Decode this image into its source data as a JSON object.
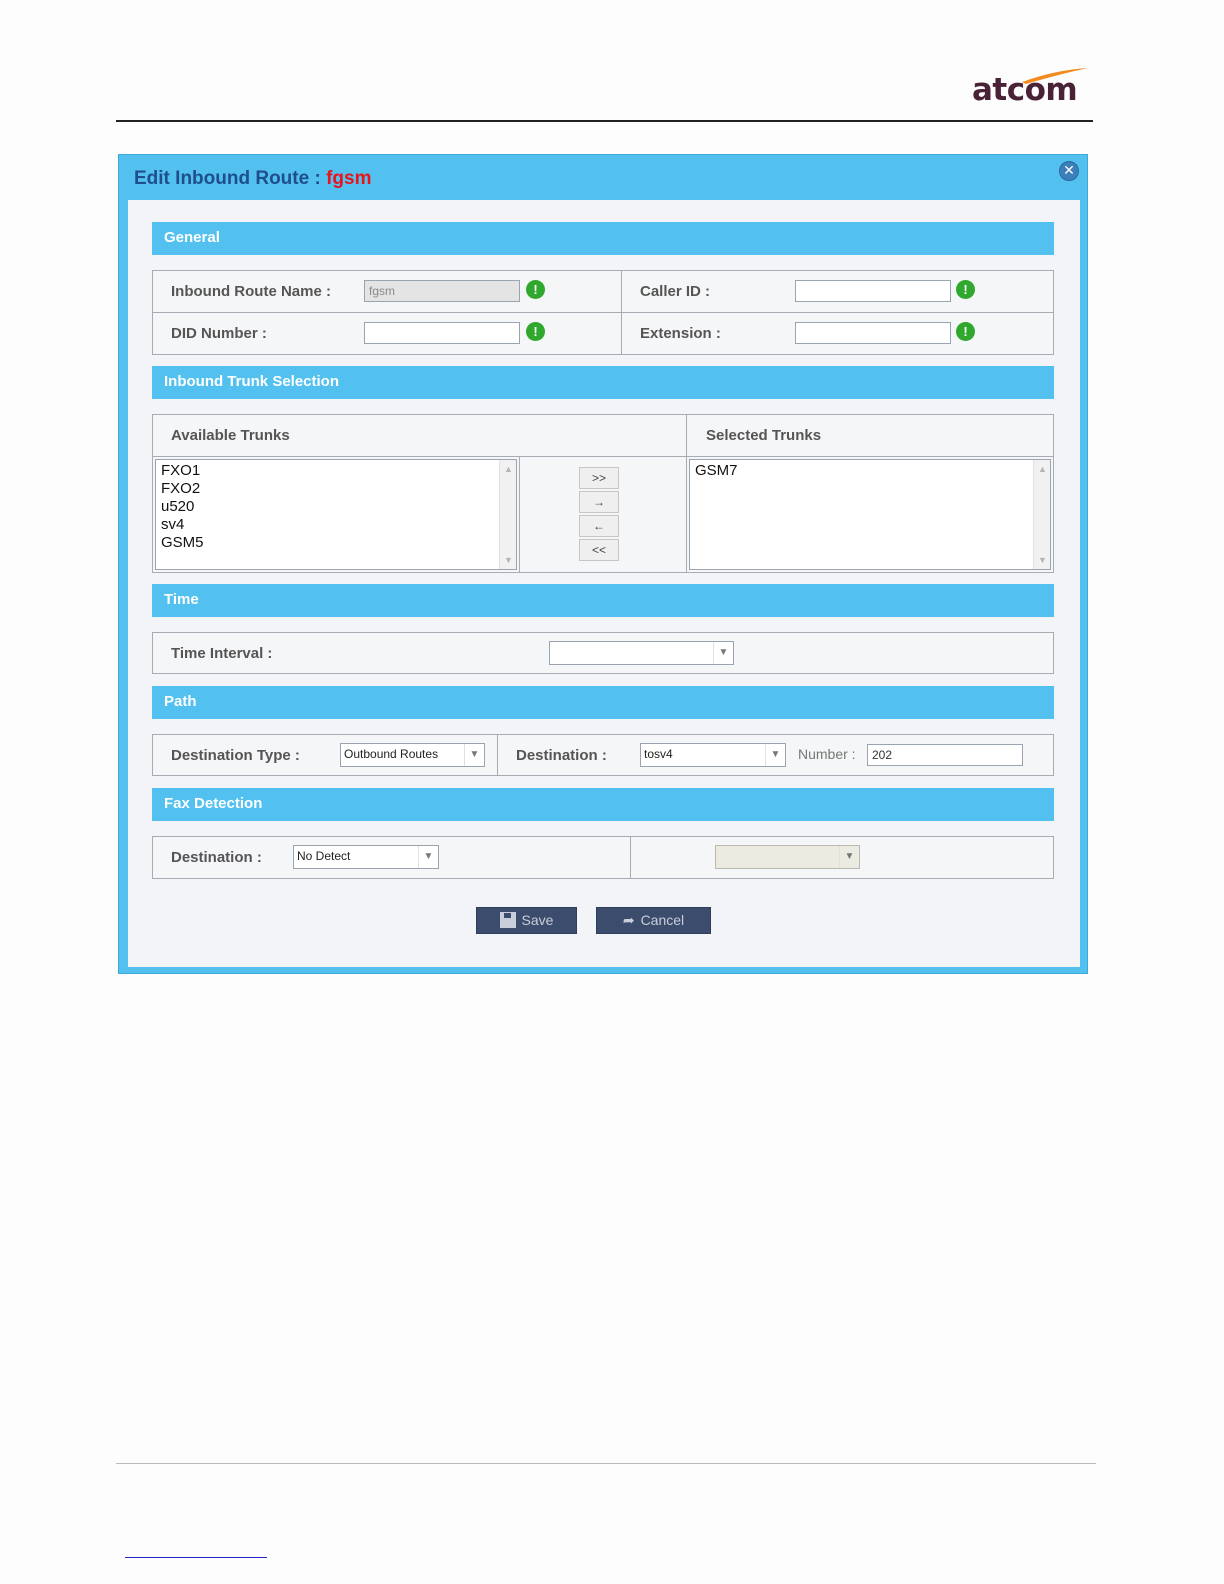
{
  "brand": {
    "logo": "atcom",
    "logo_color": "#4a2238",
    "swoosh_color": "#f28a1e"
  },
  "dialog": {
    "title_prefix": "Edit Inbound Route : ",
    "title_name": "fgsm",
    "close_glyph": "✕"
  },
  "general": {
    "header": "General",
    "route_name_label": "Inbound Route Name :",
    "route_name_value": "fgsm",
    "caller_id_label": "Caller ID :",
    "caller_id_value": "",
    "did_label": "DID Number :",
    "did_value": "",
    "extension_label": "Extension :",
    "extension_value": "",
    "warn_glyph": "!"
  },
  "trunks": {
    "header": "Inbound Trunk Selection",
    "available_label": "Available Trunks",
    "selected_label": "Selected Trunks",
    "available": [
      "FXO1",
      "FXO2",
      "u520",
      "sv4",
      "GSM5"
    ],
    "selected": [
      "GSM7"
    ],
    "buttons": {
      "add_all": ">>",
      "add": "→",
      "remove": "←",
      "remove_all": "<<"
    }
  },
  "time": {
    "header": "Time",
    "interval_label": "Time Interval :",
    "interval_value": ""
  },
  "path": {
    "header": "Path",
    "dest_type_label": "Destination Type :",
    "dest_type_value": "Outbound Routes",
    "destination_label": "Destination :",
    "destination_value": "tosv4",
    "number_label": "Number :",
    "number_value": "202"
  },
  "fax": {
    "header": "Fax Detection",
    "destination_label": "Destination :",
    "destination_value": "No Detect",
    "secondary_value": ""
  },
  "actions": {
    "save": "Save",
    "cancel": "Cancel"
  },
  "colors": {
    "accent": "#52c1f0",
    "title": "#1f4e8c",
    "route_name": "#e8141b",
    "button": "#3b4c6d",
    "warn": "#2fa82d"
  }
}
